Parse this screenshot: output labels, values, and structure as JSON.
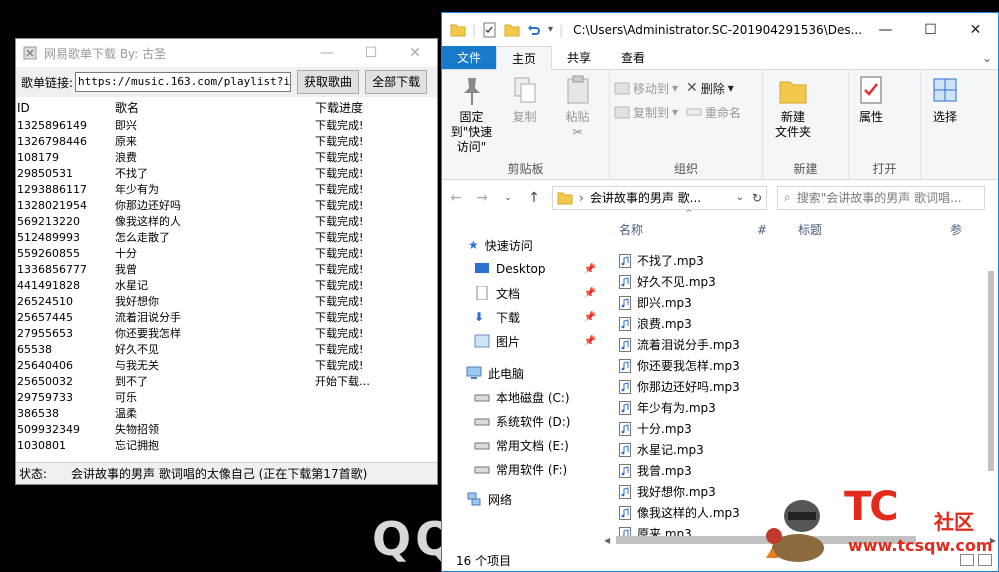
{
  "background": {
    "logo_text": "QQ"
  },
  "downloader": {
    "title": "网易歌单下载  By: 古圣",
    "url_label": "歌单链接:",
    "url_value": "https://music.163.com/playlist?id=25",
    "fetch_button": "获取歌曲",
    "download_all_button": "全部下载",
    "columns": [
      "ID",
      "歌名",
      "下载进度"
    ],
    "rows": [
      [
        "1325896149",
        "即兴",
        "下载完成!"
      ],
      [
        "1326798446",
        "原来",
        "下载完成!"
      ],
      [
        "108179",
        "浪费",
        "下载完成!"
      ],
      [
        "29850531",
        "不找了",
        "下载完成!"
      ],
      [
        "1293886117",
        "年少有为",
        "下载完成!"
      ],
      [
        "1328021954",
        "你那边还好吗",
        "下载完成!"
      ],
      [
        "569213220",
        "像我这样的人",
        "下载完成!"
      ],
      [
        "512489993",
        "怎么走散了",
        "下载完成!"
      ],
      [
        "559260855",
        "十分",
        "下载完成!"
      ],
      [
        "1336856777",
        "我曾",
        "下载完成!"
      ],
      [
        "441491828",
        "水星记",
        "下载完成!"
      ],
      [
        "26524510",
        "我好想你",
        "下载完成!"
      ],
      [
        "25657445",
        "流着泪说分手",
        "下载完成!"
      ],
      [
        "27955653",
        "你还要我怎样",
        "下载完成!"
      ],
      [
        "65538",
        "好久不见",
        "下载完成!"
      ],
      [
        "25640406",
        "与我无关",
        "下载完成!"
      ],
      [
        "25650032",
        "到不了",
        "开始下载…"
      ],
      [
        "29759733",
        "可乐",
        ""
      ],
      [
        "386538",
        "温柔",
        ""
      ],
      [
        "509932349",
        "失物招领",
        ""
      ],
      [
        "1030801",
        "忘记拥抱",
        ""
      ]
    ],
    "status_label": "状态:",
    "status_text": "会讲故事的男声 歌词唱的太像自己 (正在下载第17首歌)"
  },
  "explorer": {
    "title_path": "C:\\Users\\Administrator.SC-201904291536\\Des...",
    "tabs": [
      "文件",
      "主页",
      "共享",
      "查看"
    ],
    "groups": {
      "clipboard": {
        "label": "剪贴板",
        "pin": "固定到\"快速访问\"",
        "copy": "复制",
        "paste": "粘贴"
      },
      "organize": {
        "label": "组织",
        "move_to": "移动到",
        "copy_to": "复制到",
        "delete": "删除",
        "rename": "重命名"
      },
      "new": {
        "label": "新建",
        "new_folder": "新建\n文件夹"
      },
      "open": {
        "label": "打开",
        "properties": "属性"
      },
      "select": {
        "label": "选择"
      }
    },
    "address": "会讲故事的男声 歌...",
    "search_placeholder": "搜索\"会讲故事的男声 歌词唱...",
    "nav": {
      "quick_access": "快速访问",
      "desktop": "Desktop",
      "documents": "文档",
      "downloads": "下载",
      "pictures": "图片",
      "this_pc": "此电脑",
      "drive_c": "本地磁盘 (C:)",
      "drive_d": "系统软件 (D:)",
      "drive_e": "常用文档 (E:)",
      "drive_f": "常用软件 (F:)",
      "network": "网络"
    },
    "columns": [
      "名称",
      "#",
      "标题",
      "参"
    ],
    "files": [
      "不找了.mp3",
      "好久不见.mp3",
      "即兴.mp3",
      "浪费.mp3",
      "流着泪说分手.mp3",
      "你还要我怎样.mp3",
      "你那边还好吗.mp3",
      "年少有为.mp3",
      "十分.mp3",
      "水星记.mp3",
      "我曾.mp3",
      "我好想你.mp3",
      "像我这样的人.mp3",
      "原来.mp3"
    ],
    "item_count": "16 个项目"
  },
  "watermark": {
    "brand": "TC",
    "community": "社区",
    "url": "www.tcsqw.com"
  },
  "colors": {
    "file_tab": "#1979ca",
    "accent_border": "#1883d7",
    "watermark": "#e32a1c"
  }
}
